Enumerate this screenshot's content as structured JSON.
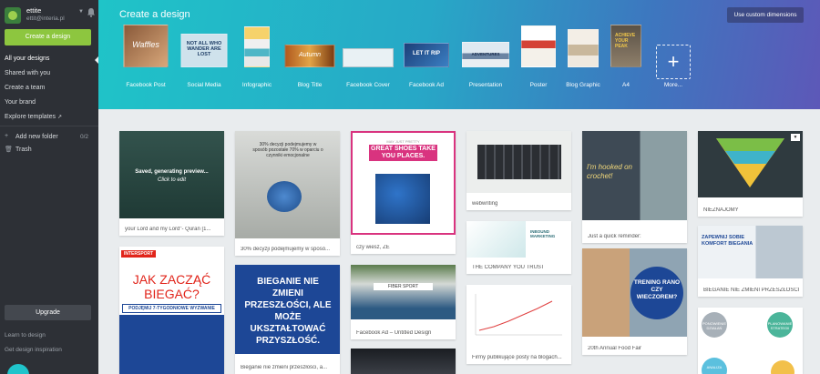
{
  "sidebar": {
    "profile": {
      "name": "ettite",
      "email": "ettit@interia.pl"
    },
    "create_button": "Create a design",
    "nav": [
      "All your designs",
      "Shared with you",
      "Create a team",
      "Your brand",
      "Explore templates"
    ],
    "add_folder": "Add new folder",
    "folder_count": "0/2",
    "trash": "Trash",
    "upgrade_button": "Upgrade",
    "learn": "Learn to design",
    "inspiration": "Get design inspiration"
  },
  "banner": {
    "title": "Create a design",
    "custom_button": "Use custom dimensions",
    "templates": [
      {
        "label": "Facebook Post",
        "thumb": "Waffles"
      },
      {
        "label": "Social Media",
        "thumb": "NOT ALL WHO WANDER ARE LOST"
      },
      {
        "label": "Infographic",
        "thumb": ""
      },
      {
        "label": "Blog Title",
        "thumb": "Autumn"
      },
      {
        "label": "Facebook Cover",
        "thumb": ""
      },
      {
        "label": "Facebook Ad",
        "thumb": "LET IT RIP"
      },
      {
        "label": "Presentation",
        "thumb": "ADVENTURES"
      },
      {
        "label": "Poster",
        "thumb": ""
      },
      {
        "label": "Blog Graphic",
        "thumb": ""
      },
      {
        "label": "A4",
        "thumb": "ACHIEVE YOUR PEAK"
      }
    ],
    "more_label": "More..."
  },
  "designs": {
    "col1": [
      {
        "caption": "your Lord and my Lord\"- Quran [1...",
        "overlay_title": "Saved, generating preview...",
        "overlay_sub": "Click to edit"
      },
      {
        "caption": "",
        "brand": "INTERSPORT",
        "headline": "JAK ZACZĄĆ BIEGAĆ?",
        "sub": "PODJĘMIJ 7-TYGODNIOWE WYZWANIE"
      }
    ],
    "col2": [
      {
        "caption": "30% decyzji podejmujemy w sposó...",
        "text": "30% decyzji podejmujemy w sposób pozostałe 70% w oparciu o czynniki emocjonalne"
      },
      {
        "caption": "Bieganie nie zmieni przeszłości, a...",
        "text": "BIEGANIE NIE ZMIENI PRZESZŁOŚCI, ALE MOŻE UKSZTAŁTOWAĆ PRZYSZŁOŚĆ."
      }
    ],
    "col3": [
      {
        "caption": "czy wiesz, ZE",
        "top": "MAY JUST PRETTY",
        "headline": "GREAT SHOES TAKE YOU PLACES."
      },
      {
        "caption": "Facebook Ad – Untitled Design",
        "text": "FIBER SPORT"
      }
    ],
    "col4": [
      {
        "caption": "webwriting"
      },
      {
        "caption": "THE COMPANY YOU TRUST",
        "text": "INBOUND MARKETING"
      },
      {
        "caption": "Firmy publikujące posty na blogach..."
      }
    ],
    "col5": [
      {
        "caption": "Just a quick reminder:",
        "text": "I'm hooked on crochet!"
      },
      {
        "caption": "20th Annual Food Fair",
        "text": "TRENING RANO CZY WIECZOREM?"
      }
    ],
    "col6": [
      {
        "caption": "NIEZNAJOMY"
      },
      {
        "caption": "BIEGANIE NIE ZMIENI PRZESZŁOŚCI...",
        "text": "ZAPEWNIJ SOBIE KOMFORT BIEGANIA"
      },
      {
        "caption": "",
        "nodes": [
          "PONOWIENIE DZIAŁAŃ",
          "PLANOWANIE STRATEGII",
          "ANALIZA"
        ]
      }
    ]
  },
  "colors": {
    "accent_green": "#8dc63f",
    "sidebar_bg": "#2d3036",
    "banner_start": "#1fc4c8",
    "banner_end": "#5d58b8"
  }
}
